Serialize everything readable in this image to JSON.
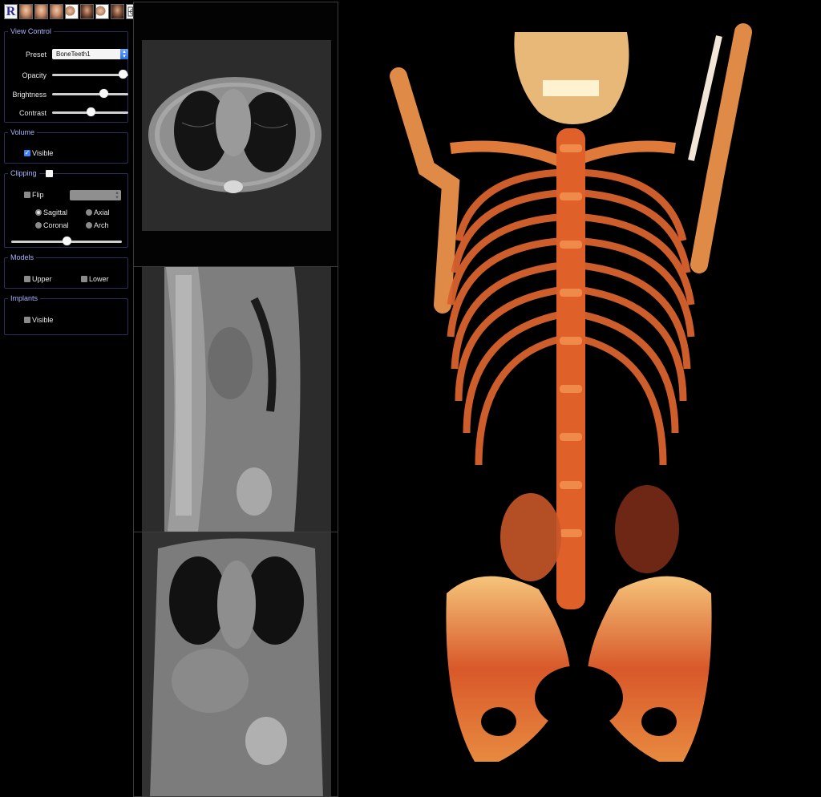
{
  "toolbar": {
    "logo_letter": "R",
    "buttons": [
      "face-front-icon",
      "face-left-icon",
      "face-right-icon",
      "face-top-icon",
      "face-profile-icon",
      "face-side-icon",
      "face-dark-icon",
      "grid-box-icon"
    ]
  },
  "view_control": {
    "legend": "View Control",
    "preset_label": "Preset",
    "preset_value": "BoneTeeth1",
    "opacity_label": "Opacity",
    "opacity_value": 1.0,
    "brightness_label": "Brightness",
    "brightness_value": 0.67,
    "contrast_label": "Contrast",
    "contrast_value": 0.5
  },
  "volume": {
    "legend": "Volume",
    "visible_label": "Visible",
    "visible_checked": true
  },
  "clipping": {
    "legend": "Clipping",
    "enabled": false,
    "flip_label": "Flip",
    "flip_checked": false,
    "flip_select_value": "",
    "options": [
      "Sagittal",
      "Axial",
      "Coronal",
      "Arch"
    ],
    "selected": "Sagittal",
    "position_value": 0.5
  },
  "models": {
    "legend": "Models",
    "upper_label": "Upper",
    "lower_label": "Lower"
  },
  "implants": {
    "legend": "Implants",
    "visible_label": "Visible"
  },
  "colors": {
    "legend": "#a9b4ff",
    "group_border": "#2b2f5c",
    "checkbox_on": "#3b82f6",
    "bone_render": "#e0642a"
  }
}
